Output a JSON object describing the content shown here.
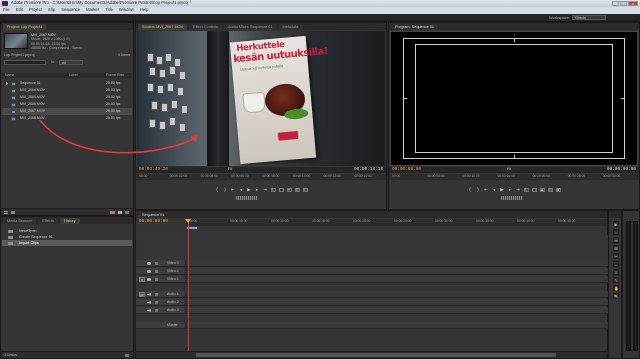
{
  "window": {
    "title": "Adobe Premiere Pro - C:\\Users\\Hm\\My Documents\\Adobe\\Premiere Pro\\5.0\\Lop Project1.prproj *",
    "controls": [
      "_",
      "□",
      "×"
    ]
  },
  "menu": [
    "File",
    "Edit",
    "Project",
    "Clip",
    "Sequence",
    "Marker",
    "Title",
    "Window",
    "Help"
  ],
  "workspace": {
    "label": "Workspace:",
    "value": "Effects"
  },
  "project": {
    "tabs": [
      "Project: Lop Project1",
      "×"
    ],
    "clip_name": "MVI_2067.MOV",
    "clip_lines": [
      "Movie, 1920 x 1080 (1.0)",
      "00:00:14:18, 25.00 fps",
      "48000 Hz - Compressed - Stereo"
    ],
    "project_name": "Lop Project1.prproj",
    "item_count": "6 Items",
    "search_placeholder": "",
    "in_label": "In:",
    "in_value": "All",
    "columns": {
      "name": "Name",
      "label": "Label",
      "rate": "Frame Rate"
    },
    "items": [
      {
        "name": "Sequence 01",
        "rate": "25.00 fps",
        "kind": "sequence"
      },
      {
        "name": "MVI_2064.MOV",
        "rate": "25.00 fps",
        "kind": "clip"
      },
      {
        "name": "MVI_2065.MOV",
        "rate": "25.00 fps",
        "kind": "clip"
      },
      {
        "name": "MVI_2066.MOV",
        "rate": "25.00 fps",
        "kind": "clip"
      },
      {
        "name": "MVI_2067.MOV",
        "rate": "25.00 fps",
        "kind": "clip",
        "selected": true
      },
      {
        "name": "MVI_2068.MOV",
        "rate": "25.00 fps",
        "kind": "clip"
      }
    ]
  },
  "history": {
    "tabs": [
      "Media Browser",
      "Effects",
      "History",
      "×"
    ],
    "items": [
      {
        "label": "New/Open",
        "selected": false
      },
      {
        "label": "Create Sequence 01",
        "selected": false
      },
      {
        "label": "Import Clips",
        "selected": true
      }
    ],
    "footer": "3 Undos"
  },
  "source": {
    "tabs": [
      "Source: MVI_2067.MOV",
      "Effect Controls",
      "Audio Mixer: Sequence 01",
      "Metadata"
    ],
    "timecode_left": "00:03:49:20",
    "timecode_right": "00:00:14:18",
    "fit": "Fit",
    "ruler": [
      "00:00",
      "00:00:02:00",
      "00:00:04:00",
      "00:00:06:00",
      "00:00:08:00",
      "00:00:10:00",
      "00:00:12:00",
      "00:00:14:00"
    ],
    "poster_line1": "Herkuttele",
    "poster_line2": "kesän uutuuksilla!",
    "poster_line3": "Uutuus kahviviivoja pullalla"
  },
  "program": {
    "tabs": [
      "Program: Sequence 01",
      "×"
    ],
    "timecode_left": "00:00:00:00",
    "timecode_right": "00:00:00:00",
    "fit": "Fit",
    "ruler": [
      "00:00",
      "00:00:05:00",
      "00:00:10:00",
      "00:00:15:00",
      "00:00:20:00",
      "00:00:25:00",
      "00:00:30:00"
    ]
  },
  "timeline": {
    "tabs": [
      "Sequence 01",
      "×"
    ],
    "timecode": "00:00:00:00",
    "ruler": [
      "00:00",
      "00:00:05:00",
      "00:00:10:00",
      "00:00:15:00",
      "00:00:20:00",
      "00:00:25:00",
      "00:00:30:00",
      "00:00:35:00",
      "00:00:40:00",
      "00:00:45:00"
    ],
    "video_tracks": [
      "Video 3",
      "Video 2",
      "Video 1"
    ],
    "audio_tracks": [
      "Audio 1",
      "Audio 2",
      "Audio 3"
    ],
    "master": "Master",
    "src_video": "V",
    "src_audio": "A1"
  },
  "tools": [
    "▶",
    "⇔",
    "⇹",
    "⊞",
    "✂",
    "↔",
    "◊",
    "✎",
    "✋",
    "🔍"
  ],
  "colors": {
    "accent": "#e8a93a",
    "annotation": "#e43a3a",
    "playhead": "#e03030"
  }
}
